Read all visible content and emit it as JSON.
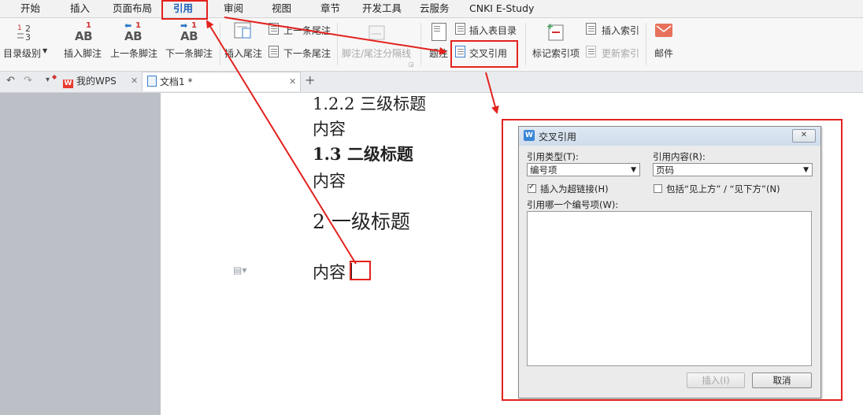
{
  "menu": {
    "tabs": [
      "开始",
      "插入",
      "页面布局",
      "引用",
      "审阅",
      "视图",
      "章节",
      "开发工具",
      "云服务",
      "CNKI E-Study"
    ],
    "active_tab": "引用"
  },
  "ribbon": {
    "toc_level": "目录级别",
    "insert_footnote": "插入脚注",
    "prev_footnote": "上一条脚注",
    "next_footnote": "下一条脚注",
    "insert_endnote": "插入尾注",
    "prev_endnote": "上一条尾注",
    "next_endnote": "下一条尾注",
    "separator_line": "脚注/尾注分隔线",
    "caption": "题注",
    "insert_table_of_figures": "插入表目录",
    "cross_reference": "交叉引用",
    "mark_index_entry": "标记索引项",
    "insert_index": "插入索引",
    "update_index": "更新索引",
    "mail": "邮件",
    "ab_text": "AB",
    "sup_one": "1"
  },
  "tabstrip": {
    "tabs": [
      {
        "label": "我的WPS"
      },
      {
        "label": "文档1 *"
      }
    ],
    "wps_logo": "W"
  },
  "document": {
    "lines": [
      "1.2.2 三级标题",
      "内容",
      "二级标题",
      "内容",
      "2 一级标题",
      "内容"
    ],
    "h2_number": "1.3"
  },
  "dialog": {
    "title": "交叉引用",
    "ref_type_label": "引用类型(T):",
    "ref_type_value": "编号项",
    "ref_content_label": "引用内容(R):",
    "ref_content_value": "页码",
    "hyperlink_label": "插入为超链接(H)",
    "hyperlink_checked": true,
    "include_label": "包括“见上方” / “见下方”(N)",
    "include_checked": false,
    "which_label": "引用哪一个编号项(W):",
    "insert_button": "插入(I)",
    "cancel_button": "取消",
    "close_glyph": "✕",
    "icon_letter": "W"
  },
  "colors": {
    "annotation": "#e3221e",
    "accent": "#1d5fb8"
  }
}
